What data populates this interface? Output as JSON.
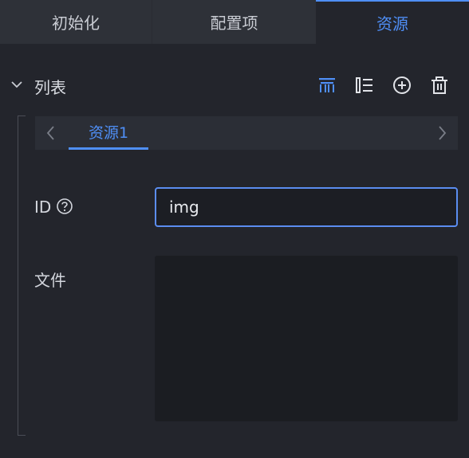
{
  "tabs": [
    {
      "label": "初始化"
    },
    {
      "label": "配置项"
    },
    {
      "label": "资源",
      "active": true
    }
  ],
  "list": {
    "title": "列表",
    "icons": [
      "collapse-all-icon",
      "list-outline-icon",
      "add-circle-icon",
      "delete-icon"
    ]
  },
  "resources": {
    "tabs": [
      {
        "label": "资源1"
      }
    ]
  },
  "form": {
    "id_label": "ID",
    "id_value": "img",
    "file_label": "文件"
  },
  "colors": {
    "accent": "#4f8ff7",
    "background": "#23252c"
  }
}
